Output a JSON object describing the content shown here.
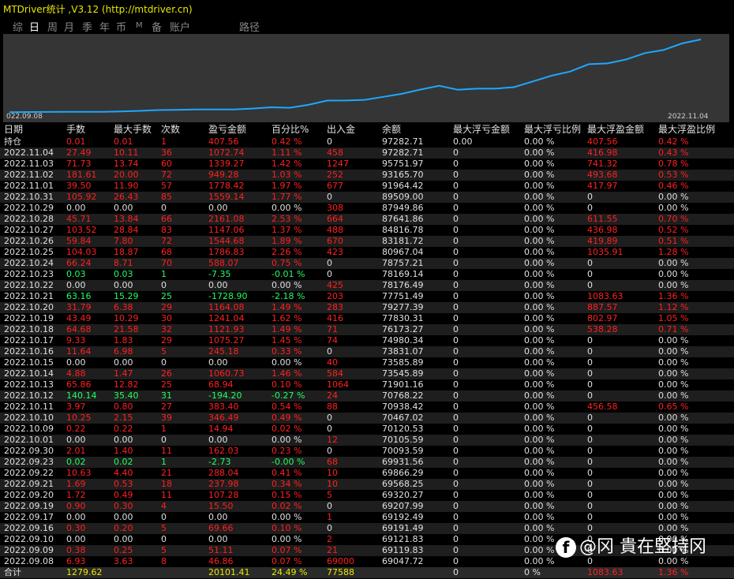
{
  "window": {
    "title": "MTDriver统计 ,V3.12 (http://mtdriver.cn)"
  },
  "tabs": [
    "综",
    "日",
    "周",
    "月",
    "季",
    "年",
    "币",
    "M",
    "备",
    "账户",
    "路径"
  ],
  "active_tab": "日",
  "colors": {
    "accent_line": "#1ea7ff",
    "loss": "#ff2020",
    "profit": "#20ff60",
    "title": "#e8e800"
  },
  "chart": {
    "x_start": "022.09.08",
    "x_end": "2022.11.04"
  },
  "chart_data": {
    "type": "line",
    "series": [
      {
        "values": [
          69047.72,
          69119.83,
          69121.83,
          69191.49,
          69192.49,
          69207.99,
          69320.27,
          69568.25,
          69866.29,
          69931.56,
          70093.59,
          70105.59,
          70120.53,
          70467.02,
          70938.42,
          70768.22,
          71901.16,
          73545.89,
          73585.89,
          73831.07,
          74980.34,
          76173.27,
          77830.31,
          79277.39,
          77751.49,
          78176.49,
          78169.14,
          78757.21,
          80967.04,
          83181.72,
          84816.78,
          87641.86,
          87949.86,
          89509.0,
          91964.42,
          93165.7,
          95751.97,
          97282.71
        ]
      }
    ],
    "x": [
      "2022.09.08",
      "2022.09.09",
      "2022.09.10",
      "2022.09.16",
      "2022.09.17",
      "2022.09.19",
      "2022.09.20",
      "2022.09.21",
      "2022.09.22",
      "2022.09.23",
      "2022.09.30",
      "2022.10.01",
      "2022.10.09",
      "2022.10.10",
      "2022.10.11",
      "2022.10.12",
      "2022.10.13",
      "2022.10.14",
      "2022.10.15",
      "2022.10.16",
      "2022.10.17",
      "2022.10.18",
      "2022.10.19",
      "2022.10.20",
      "2022.10.21",
      "2022.10.22",
      "2022.10.23",
      "2022.10.24",
      "2022.10.25",
      "2022.10.26",
      "2022.10.27",
      "2022.10.28",
      "2022.10.29",
      "2022.10.31",
      "2022.11.01",
      "2022.11.02",
      "2022.11.03",
      "2022.11.04"
    ],
    "grid": false
  },
  "table": {
    "headers": [
      "日期",
      "手数",
      "最大手数",
      "次数",
      "盈亏金额",
      "百分比%",
      "出入金",
      "余额",
      "最大浮亏金额",
      "最大浮亏比例",
      "最大浮盈金额",
      "最大浮盈比例"
    ],
    "rows": [
      {
        "c": [
          "持仓",
          "0.01",
          "0.01",
          "1",
          "407.56",
          "0.42 %",
          "0",
          "97282.71",
          "0.00",
          "0.00 %",
          "407.56",
          "0.42 %"
        ],
        "k": "r"
      },
      {
        "c": [
          "2022.11.04",
          "27.49",
          "10.11",
          "36",
          "1072.74",
          "1.11 %",
          "458",
          "97282.71",
          "0",
          "0.00 %",
          "416.98",
          "0.43 %"
        ],
        "k": "r"
      },
      {
        "c": [
          "2022.11.03",
          "71.73",
          "13.74",
          "60",
          "1339.27",
          "1.42 %",
          "1247",
          "95751.97",
          "0",
          "0.00 %",
          "741.32",
          "0.78 %"
        ],
        "k": "r"
      },
      {
        "c": [
          "2022.11.02",
          "181.61",
          "20.00",
          "72",
          "949.28",
          "1.03 %",
          "252",
          "93165.70",
          "0",
          "0.00 %",
          "493.68",
          "0.53 %"
        ],
        "k": "r"
      },
      {
        "c": [
          "2022.11.01",
          "39.50",
          "11.90",
          "57",
          "1778.42",
          "1.97 %",
          "677",
          "91964.42",
          "0",
          "0.00 %",
          "417.97",
          "0.46 %"
        ],
        "k": "r"
      },
      {
        "c": [
          "2022.10.31",
          "105.92",
          "26.43",
          "85",
          "1559.14",
          "1.77 %",
          "0",
          "89509.00",
          "0",
          "0.00 %",
          "0",
          "0.00 %"
        ],
        "k": "r"
      },
      {
        "c": [
          "2022.10.29",
          "0.00",
          "0.00",
          "0",
          "0.00",
          "0.00 %",
          "308",
          "87949.86",
          "0",
          "0.00 %",
          "0",
          "0.00 %"
        ],
        "k": "w"
      },
      {
        "c": [
          "2022.10.28",
          "45.71",
          "13.84",
          "66",
          "2161.08",
          "2.53 %",
          "664",
          "87641.86",
          "0",
          "0.00 %",
          "611.55",
          "0.70 %"
        ],
        "k": "r"
      },
      {
        "c": [
          "2022.10.27",
          "103.52",
          "28.84",
          "83",
          "1147.06",
          "1.37 %",
          "488",
          "84816.78",
          "0",
          "0.00 %",
          "436.98",
          "0.52 %"
        ],
        "k": "r"
      },
      {
        "c": [
          "2022.10.26",
          "59.84",
          "7.80",
          "72",
          "1544.68",
          "1.89 %",
          "670",
          "83181.72",
          "0",
          "0.00 %",
          "419.89",
          "0.51 %"
        ],
        "k": "r"
      },
      {
        "c": [
          "2022.10.25",
          "104.03",
          "18.87",
          "68",
          "1786.83",
          "2.26 %",
          "423",
          "80967.04",
          "0",
          "0.00 %",
          "1035.91",
          "1.28 %"
        ],
        "k": "r"
      },
      {
        "c": [
          "2022.10.24",
          "66.24",
          "8.71",
          "70",
          "588.07",
          "0.75 %",
          "0",
          "78757.21",
          "0",
          "0.00 %",
          "0",
          "0.00 %"
        ],
        "k": "r"
      },
      {
        "c": [
          "2022.10.23",
          "0.03",
          "0.03",
          "1",
          "-7.35",
          "-0.01 %",
          "0",
          "78169.14",
          "0",
          "0.00 %",
          "0",
          "0.00 %"
        ],
        "k": "g"
      },
      {
        "c": [
          "2022.10.22",
          "0.00",
          "0.00",
          "0",
          "0.00",
          "0.00 %",
          "425",
          "78176.49",
          "0",
          "0.00 %",
          "0",
          "0.00 %"
        ],
        "k": "w"
      },
      {
        "c": [
          "2022.10.21",
          "63.16",
          "15.29",
          "25",
          "-1728.90",
          "-2.18 %",
          "203",
          "77751.49",
          "0",
          "0.00 %",
          "1083.63",
          "1.36 %"
        ],
        "k": "g"
      },
      {
        "c": [
          "2022.10.20",
          "31.79",
          "6.38",
          "29",
          "1164.08",
          "1.49 %",
          "283",
          "79277.39",
          "0",
          "0.00 %",
          "887.57",
          "1.12 %"
        ],
        "k": "r"
      },
      {
        "c": [
          "2022.10.19",
          "43.49",
          "10.29",
          "30",
          "1241.04",
          "1.62 %",
          "416",
          "77830.31",
          "0",
          "0.00 %",
          "802.97",
          "1.05 %"
        ],
        "k": "r"
      },
      {
        "c": [
          "2022.10.18",
          "64.68",
          "21.58",
          "32",
          "1121.93",
          "1.49 %",
          "71",
          "76173.27",
          "0",
          "0.00 %",
          "538.28",
          "0.71 %"
        ],
        "k": "r"
      },
      {
        "c": [
          "2022.10.17",
          "9.33",
          "1.83",
          "29",
          "1075.27",
          "1.45 %",
          "74",
          "74980.34",
          "0",
          "0.00 %",
          "0",
          "0.00 %"
        ],
        "k": "r"
      },
      {
        "c": [
          "2022.10.16",
          "11.64",
          "6.98",
          "5",
          "245.18",
          "0.33 %",
          "0",
          "73831.07",
          "0",
          "0.00 %",
          "0",
          "0.00 %"
        ],
        "k": "r"
      },
      {
        "c": [
          "2022.10.15",
          "0.00",
          "0.00",
          "0",
          "0.00",
          "0.00 %",
          "40",
          "73585.89",
          "0",
          "0.00 %",
          "0",
          "0.00 %"
        ],
        "k": "w"
      },
      {
        "c": [
          "2022.10.14",
          "4.88",
          "1.47",
          "26",
          "1060.73",
          "1.46 %",
          "584",
          "73545.89",
          "0",
          "0.00 %",
          "0",
          "0.00 %"
        ],
        "k": "r"
      },
      {
        "c": [
          "2022.10.13",
          "65.86",
          "12.82",
          "25",
          "68.94",
          "0.10 %",
          "1064",
          "71901.16",
          "0",
          "0.00 %",
          "0",
          "0.00 %"
        ],
        "k": "r"
      },
      {
        "c": [
          "2022.10.12",
          "140.14",
          "35.40",
          "31",
          "-194.20",
          "-0.27 %",
          "24",
          "70768.22",
          "0",
          "0.00 %",
          "0",
          "0.00 %"
        ],
        "k": "g"
      },
      {
        "c": [
          "2022.10.11",
          "3.97",
          "0.80",
          "27",
          "383.40",
          "0.54 %",
          "88",
          "70938.42",
          "0",
          "0.00 %",
          "456.58",
          "0.65 %"
        ],
        "k": "r"
      },
      {
        "c": [
          "2022.10.10",
          "10.25",
          "2.15",
          "39",
          "346.49",
          "0.49 %",
          "0",
          "70467.02",
          "0",
          "0.00 %",
          "0",
          "0.00 %"
        ],
        "k": "r"
      },
      {
        "c": [
          "2022.10.09",
          "0.22",
          "0.22",
          "1",
          "14.94",
          "0.02 %",
          "0",
          "70120.53",
          "0",
          "0.00 %",
          "0",
          "0.00 %"
        ],
        "k": "r"
      },
      {
        "c": [
          "2022.10.01",
          "0.00",
          "0.00",
          "0",
          "0.00",
          "0.00 %",
          "12",
          "70105.59",
          "0",
          "0.00 %",
          "0",
          "0.00 %"
        ],
        "k": "w"
      },
      {
        "c": [
          "2022.09.30",
          "2.01",
          "1.40",
          "11",
          "162.03",
          "0.23 %",
          "0",
          "70093.59",
          "0",
          "0.00 %",
          "0",
          "0.00 %"
        ],
        "k": "r"
      },
      {
        "c": [
          "2022.09.23",
          "0.02",
          "0.02",
          "1",
          "-2.73",
          "-0.00 %",
          "68",
          "69931.56",
          "0",
          "0.00 %",
          "0",
          "0.00 %"
        ],
        "k": "g"
      },
      {
        "c": [
          "2022.09.22",
          "10.63",
          "4.40",
          "21",
          "288.04",
          "0.41 %",
          "10",
          "69866.29",
          "0",
          "0.00 %",
          "0",
          "0.00 %"
        ],
        "k": "r"
      },
      {
        "c": [
          "2022.09.21",
          "1.69",
          "0.53",
          "18",
          "237.98",
          "0.34 %",
          "10",
          "69568.25",
          "0",
          "0.00 %",
          "0",
          "0.00 %"
        ],
        "k": "r"
      },
      {
        "c": [
          "2022.09.20",
          "1.72",
          "0.49",
          "11",
          "107.28",
          "0.15 %",
          "5",
          "69320.27",
          "0",
          "0.00 %",
          "0",
          "0.00 %"
        ],
        "k": "r"
      },
      {
        "c": [
          "2022.09.19",
          "0.90",
          "0.30",
          "4",
          "15.50",
          "0.02 %",
          "0",
          "69207.99",
          "0",
          "0.00 %",
          "0",
          "0.00 %"
        ],
        "k": "r"
      },
      {
        "c": [
          "2022.09.17",
          "0.00",
          "0.00",
          "0",
          "0.00",
          "0.00 %",
          "1",
          "69192.49",
          "0",
          "0.00 %",
          "0",
          "0.00 %"
        ],
        "k": "w"
      },
      {
        "c": [
          "2022.09.16",
          "0.30",
          "0.20",
          "5",
          "69.66",
          "0.10 %",
          "0",
          "69191.49",
          "0",
          "0.00 %",
          "0",
          "0.00 %"
        ],
        "k": "r"
      },
      {
        "c": [
          "2022.09.10",
          "0.00",
          "0.00",
          "0",
          "0.00",
          "0.00 %",
          "2",
          "69121.83",
          "0",
          "0.00 %",
          "0",
          "0.00 %"
        ],
        "k": "w"
      },
      {
        "c": [
          "2022.09.09",
          "0.38",
          "0.25",
          "5",
          "51.11",
          "0.07 %",
          "21",
          "69119.83",
          "0",
          "0.00 %",
          "0",
          "0.00 %"
        ],
        "k": "r"
      },
      {
        "c": [
          "2022.09.08",
          "6.93",
          "3.63",
          "8",
          "46.86",
          "0.07 %",
          "69000",
          "69047.72",
          "0",
          "0.00 %",
          "0",
          "0.00 %"
        ],
        "k": "r"
      }
    ],
    "total": [
      "合计",
      "1279.62",
      "",
      "",
      "20101.41",
      "24.49 %",
      "77588",
      "",
      "0",
      "0 %",
      "1083.63",
      "1.36 %"
    ]
  },
  "watermark": {
    "text": "@冈 貴在堅持冈",
    "logo": "f"
  }
}
